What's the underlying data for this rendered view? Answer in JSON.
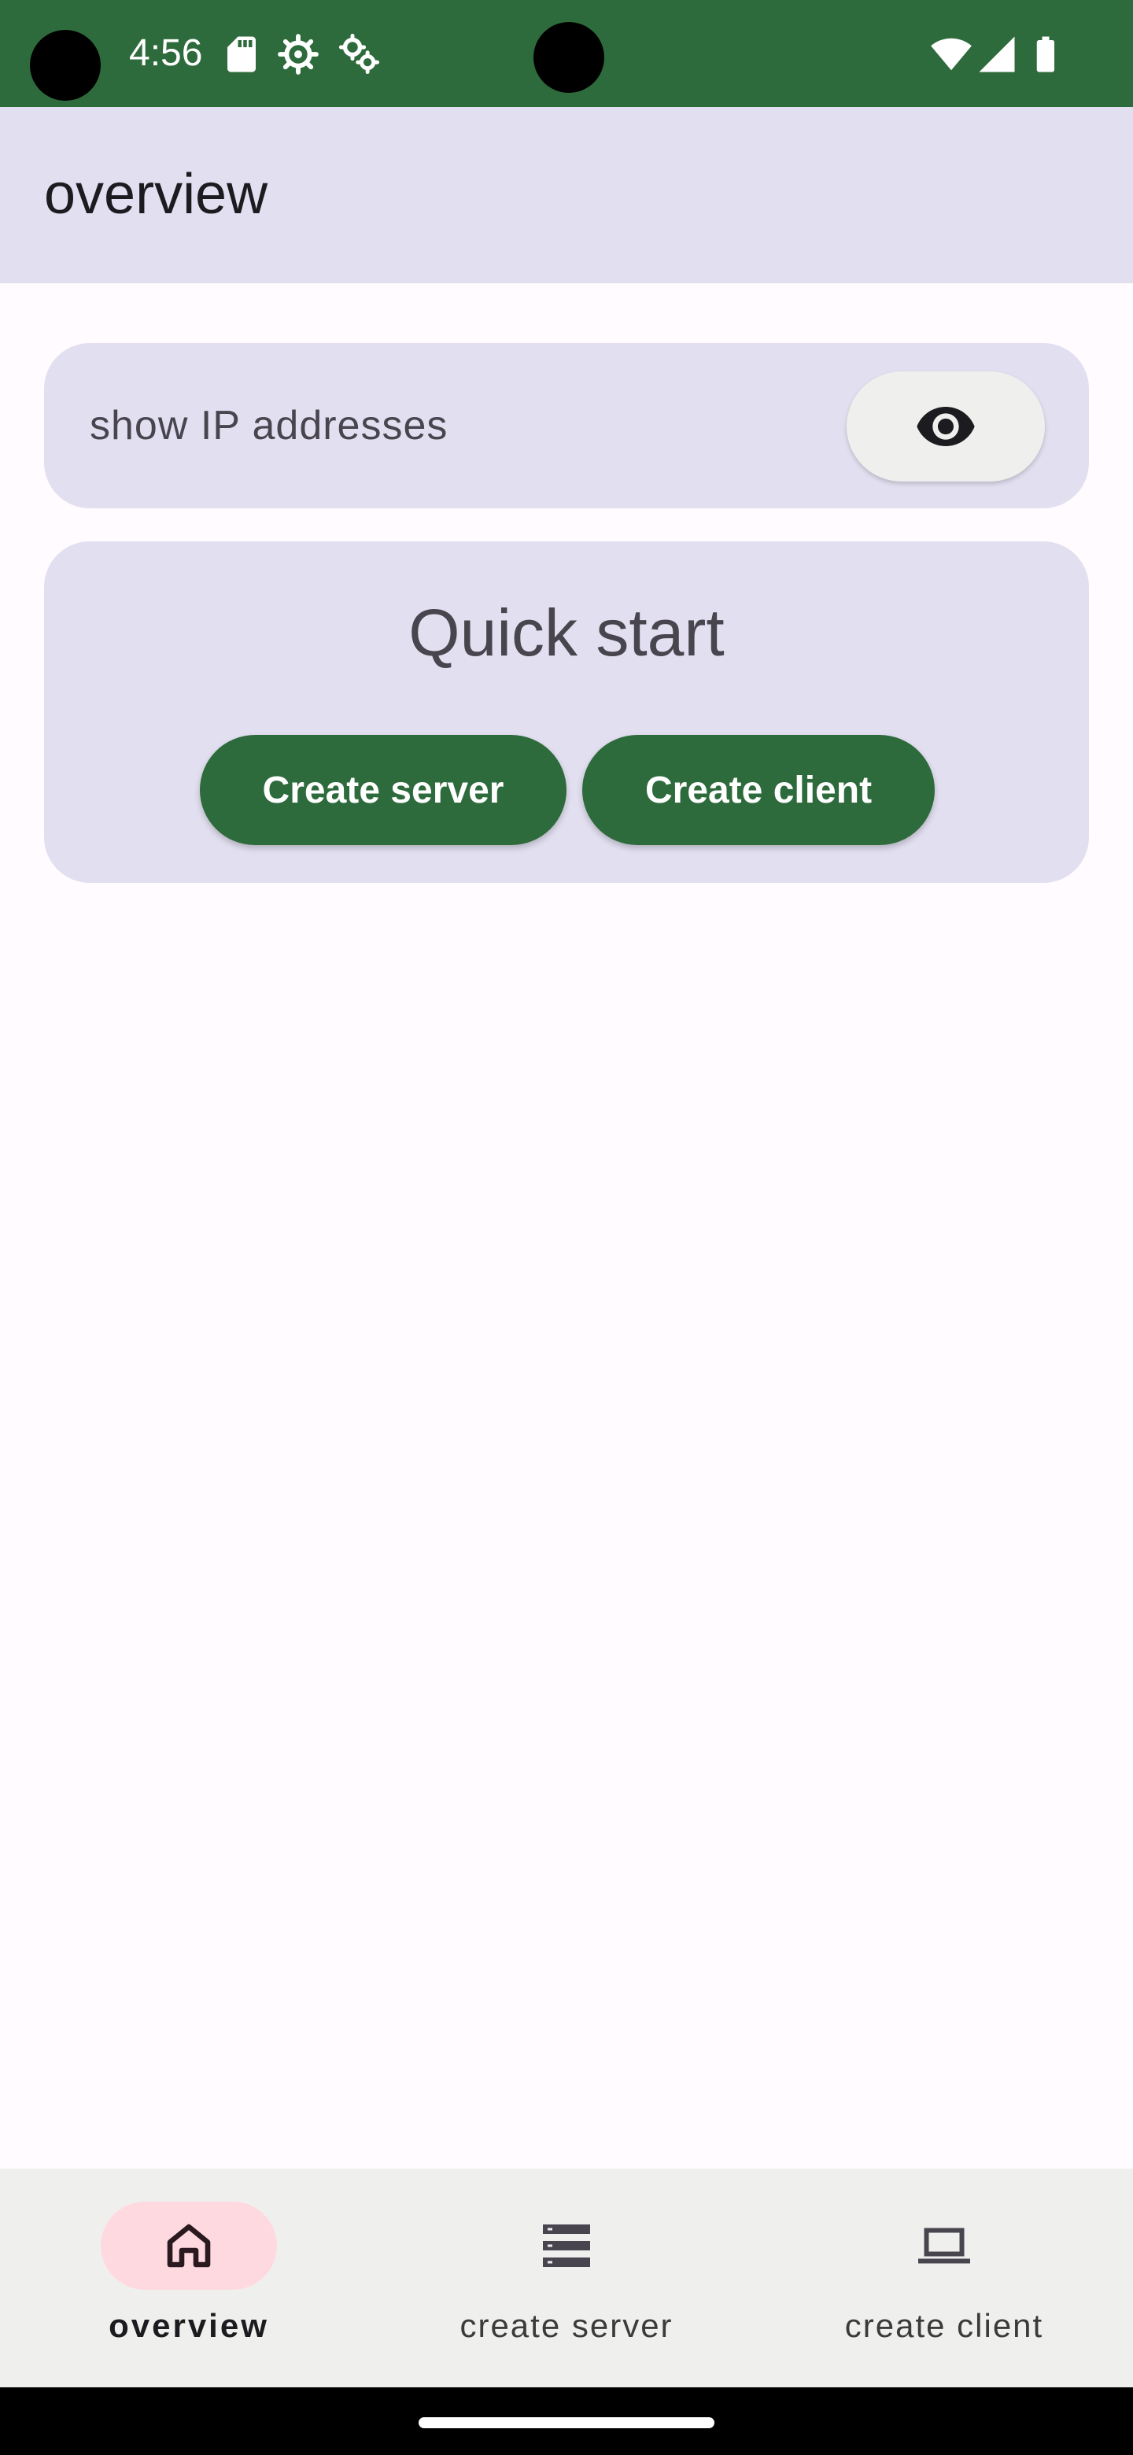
{
  "status_bar": {
    "time": "4:56",
    "left_icons": [
      "sd-card-icon",
      "settings-gear-icon",
      "settings-gears-icon"
    ],
    "right_icons": [
      "wifi-icon",
      "cell-signal-icon",
      "battery-icon"
    ]
  },
  "app_bar": {
    "title": "overview"
  },
  "ip_card": {
    "label": "show IP addresses",
    "toggle_icon": "visibility-eye-icon"
  },
  "quick_start": {
    "title": "Quick start",
    "create_server_label": "Create server",
    "create_client_label": "Create client"
  },
  "bottom_nav": {
    "items": [
      {
        "label": "overview",
        "icon": "home-icon",
        "active": true
      },
      {
        "label": "create server",
        "icon": "server-list-icon",
        "active": false
      },
      {
        "label": "create client",
        "icon": "laptop-icon",
        "active": false
      }
    ]
  },
  "colors": {
    "primary": "#2e6b3c",
    "surface_variant": "#e2e0f0",
    "active_nav_indicator": "#ffd9e0",
    "background": "#fffbfe"
  }
}
